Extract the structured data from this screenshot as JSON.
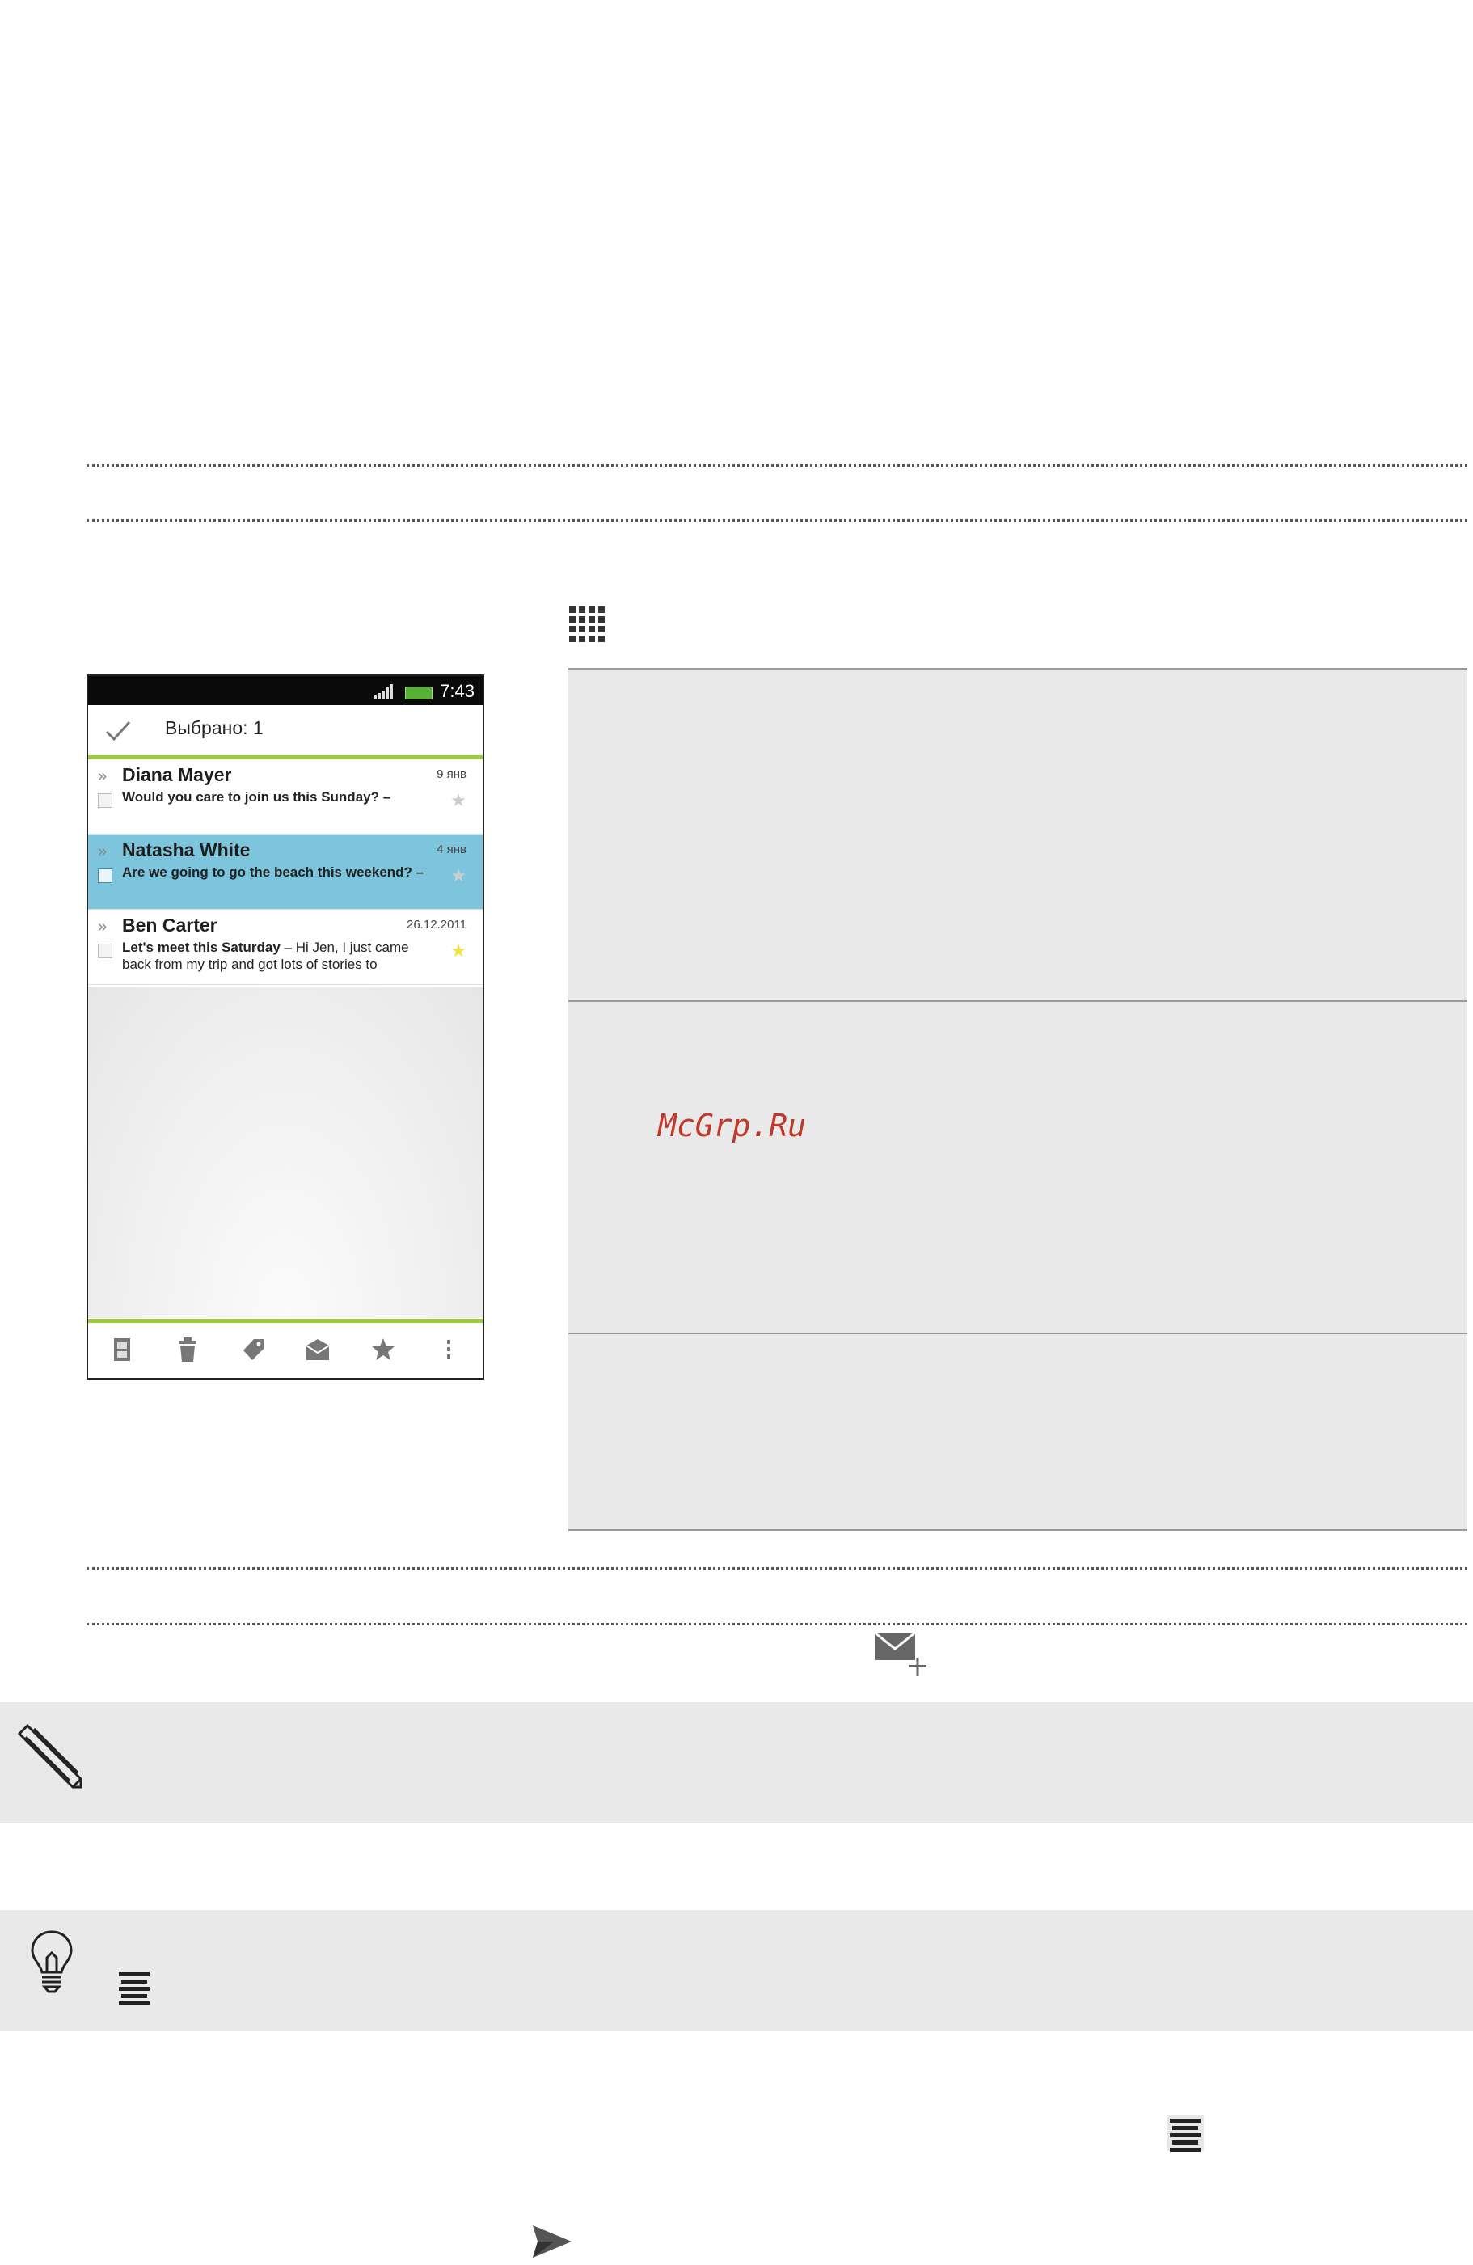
{
  "phone": {
    "status_time": "7:43",
    "selection_text": "Выбрано: 1",
    "messages": [
      {
        "sender": "Diana Mayer",
        "date": "9 янв",
        "subject": "Would you care to join us this Sunday? –",
        "preview": "",
        "checked": false,
        "starred": false
      },
      {
        "sender": "Natasha White",
        "date": "4 янв",
        "subject": "Are we going to go the beach this weekend? –",
        "preview": "",
        "checked": true,
        "starred": false
      },
      {
        "sender": "Ben Carter",
        "date": "26.12.2011",
        "subject": "Let's meet this Saturday",
        "preview": " – Hi Jen, I just came back from my trip and got lots of stories to",
        "checked": false,
        "starred": true
      }
    ],
    "toolbar_icons": [
      "read-unread-icon",
      "trash-icon",
      "label-icon",
      "archive-icon",
      "star-icon",
      "more-icon"
    ],
    "accent_color": "#9ccb3b",
    "selected_color": "#7cc5dc"
  },
  "watermark": "McGrp.Ru",
  "icons": [
    "apps-grid-icon",
    "compose-mail-icon",
    "pencil-note-icon",
    "lightbulb-tip-icon",
    "menu-icon",
    "send-icon"
  ]
}
